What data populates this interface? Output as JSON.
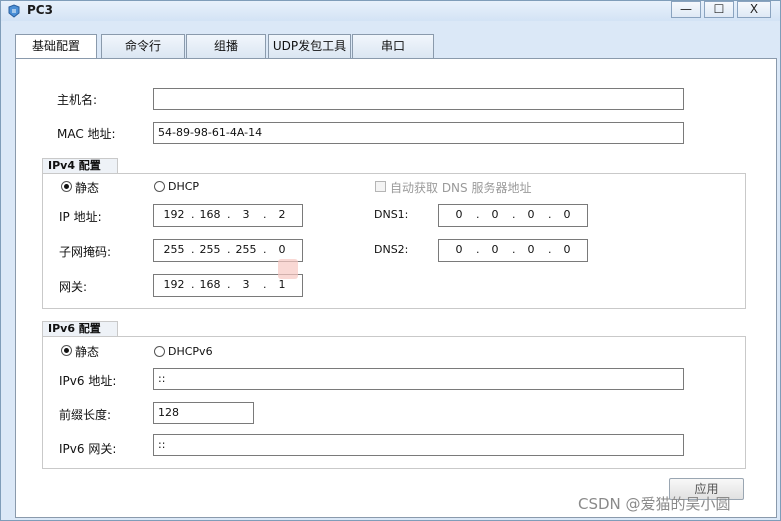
{
  "window": {
    "title": "PC3"
  },
  "window_controls": {
    "minimize": "—",
    "maximize": "☐",
    "close": "X"
  },
  "tabs": [
    "基础配置",
    "命令行",
    "组播",
    "UDP发包工具",
    "串口"
  ],
  "basic": {
    "hostname_label": "主机名:",
    "hostname_value": "",
    "mac_label": "MAC 地址:",
    "mac_value": "54-89-98-61-4A-14"
  },
  "ipv4": {
    "legend": "IPv4 配置",
    "static_label": "静态",
    "dhcp_label": "DHCP",
    "auto_dns_label": "自动获取 DNS 服务器地址",
    "ip_label": "IP 地址:",
    "ip": [
      "192",
      "168",
      "3",
      "2"
    ],
    "mask_label": "子网掩码:",
    "mask": [
      "255",
      "255",
      "255",
      "0"
    ],
    "gateway_label": "网关:",
    "gateway": [
      "192",
      "168",
      "3",
      "1"
    ],
    "dns1_label": "DNS1:",
    "dns1": [
      "0",
      "0",
      "0",
      "0"
    ],
    "dns2_label": "DNS2:",
    "dns2": [
      "0",
      "0",
      "0",
      "0"
    ]
  },
  "ipv6": {
    "legend": "IPv6 配置",
    "static_label": "静态",
    "dhcp_label": "DHCPv6",
    "addr_label": "IPv6 地址:",
    "addr_value": "::",
    "prefix_label": "前缀长度:",
    "prefix_value": "128",
    "gateway_label": "IPv6 网关:",
    "gateway_value": "::"
  },
  "apply_label": "应用",
  "watermark": "CSDN @爱猫的吴小圆",
  "colors": {
    "titlebar": "#d3e3f5",
    "panel": "#ffffff",
    "window_bg": "#dbe8f7"
  }
}
